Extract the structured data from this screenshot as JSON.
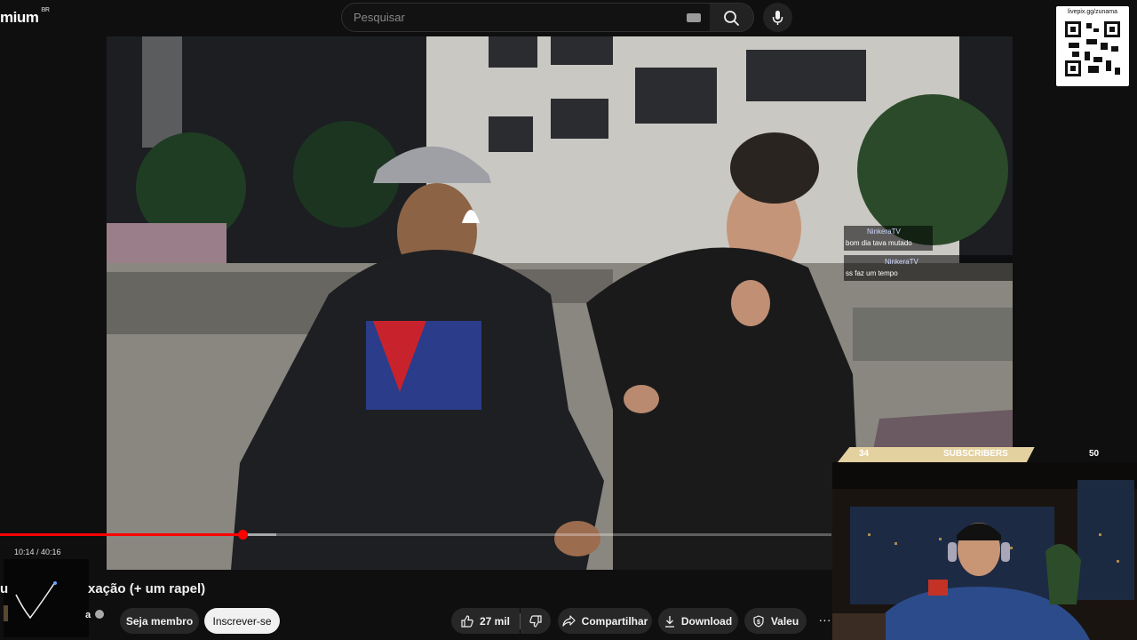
{
  "header": {
    "logo_text": "mium",
    "logo_region": "BR",
    "search_placeholder": "Pesquisar"
  },
  "overlay": {
    "qr_label": "livepix.gg/zunama",
    "chat": [
      {
        "user": "NinkeraTV",
        "message": "bom dia tava mutado"
      },
      {
        "user": "NinkeraTV",
        "message": "ss faz um tempo"
      }
    ],
    "subs_goal": {
      "current": "34",
      "label": "SUBSCRIBERS",
      "goal": "50",
      "progress_fraction": 0.68
    }
  },
  "player": {
    "time_display": "10:14 / 40:16",
    "played_fraction": 0.2918,
    "buffered_fraction": 0.3325
  },
  "video": {
    "title_fragment_left": "u",
    "title": "xação (+ um rapel)",
    "channel_fragment": "a"
  },
  "actions": {
    "join_label": "Seja membro",
    "subscribe_label": "Inscrever-se",
    "like_count": "27 mil",
    "share_label": "Compartilhar",
    "download_label": "Download",
    "thanks_label": "Valeu",
    "more_label": "···"
  },
  "colors": {
    "accent_red": "#ff0000",
    "background": "#0f0f0f",
    "button_bg": "#272727",
    "subs_bar": "#e4d1a0"
  }
}
